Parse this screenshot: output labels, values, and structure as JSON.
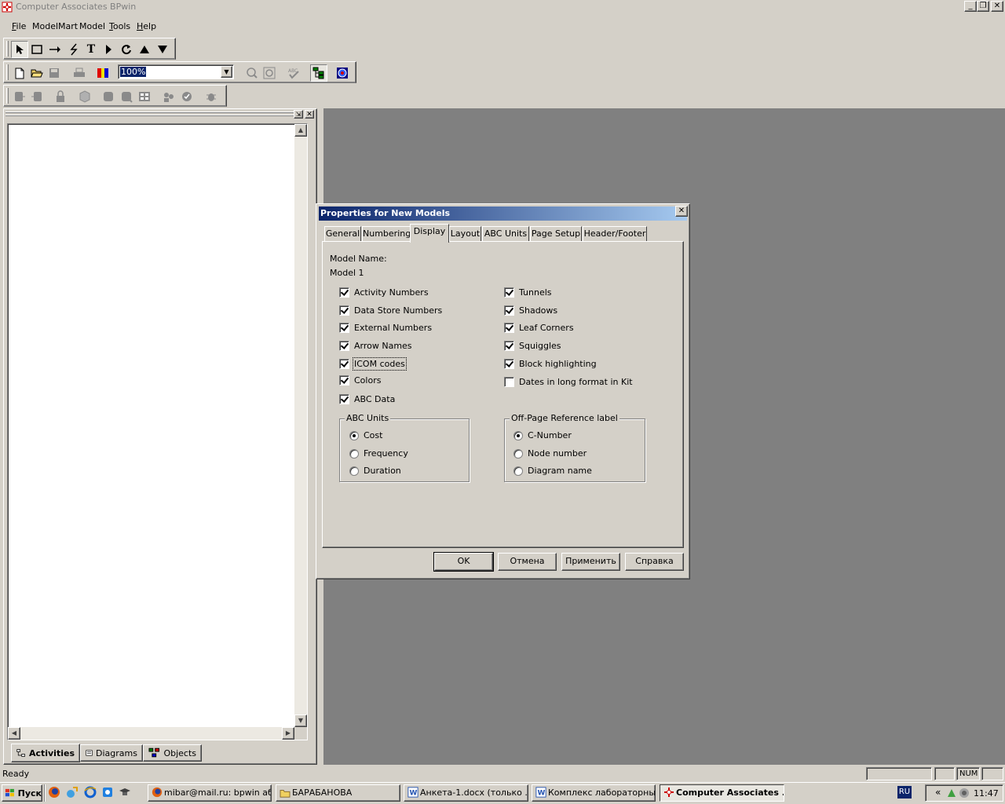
{
  "window": {
    "title": "Computer Associates BPwin",
    "min": "_",
    "restore": "❐",
    "close": "✕"
  },
  "menu": {
    "items": [
      {
        "accel": "F",
        "rest": "ile"
      },
      {
        "accel": "",
        "rest": "ModelMart"
      },
      {
        "accel": "",
        "rest": "Model"
      },
      {
        "accel": "T",
        "rest": "ools"
      },
      {
        "accel": "H",
        "rest": "elp"
      }
    ]
  },
  "toolbar": {
    "zoom": "100%"
  },
  "left_pane": {
    "tabs": [
      "Activities",
      "Diagrams",
      "Objects"
    ]
  },
  "dialog": {
    "title": "Properties for New Models",
    "tabs": [
      "General",
      "Numbering",
      "Display",
      "Layout",
      "ABC Units",
      "Page Setup",
      "Header/Footer"
    ],
    "active_tab": "Display",
    "model_name_label": "Model Name:",
    "model_name_value": "Model 1",
    "left_checks": [
      {
        "label": "Activity Numbers",
        "checked": true
      },
      {
        "label": "Data Store Numbers",
        "checked": true
      },
      {
        "label": "External Numbers",
        "checked": true
      },
      {
        "label": "Arrow Names",
        "checked": true
      },
      {
        "label": "ICOM codes",
        "checked": true
      },
      {
        "label": "Colors",
        "checked": true
      },
      {
        "label": "ABC Data",
        "checked": true
      }
    ],
    "right_checks": [
      {
        "label": "Tunnels",
        "checked": true
      },
      {
        "label": "Shadows",
        "checked": true
      },
      {
        "label": "Leaf Corners",
        "checked": true
      },
      {
        "label": "Squiggles",
        "checked": true
      },
      {
        "label": "Block highlighting",
        "checked": true
      },
      {
        "label": "Dates in long format in Kit",
        "checked": false
      }
    ],
    "abc_units": {
      "title": "ABC Units",
      "options": [
        "Cost",
        "Frequency",
        "Duration"
      ],
      "selected": "Cost"
    },
    "off_page": {
      "title": "Off-Page Reference label",
      "options": [
        "C-Number",
        "Node number",
        "Diagram name"
      ],
      "selected": "C-Number"
    },
    "buttons": {
      "ok": "OK",
      "cancel": "Отмена",
      "apply": "Применить",
      "help": "Справка"
    }
  },
  "statusbar": {
    "text": "Ready",
    "num": "NUM"
  },
  "taskbar": {
    "start": "Пуск",
    "tasks": [
      "mibar@mail.ru: bpwin аб...",
      "БАРАБАНОВА",
      "Анкета-1.docx (только ...",
      "Комплекс лабораторны...",
      "Computer Associates ..."
    ],
    "lang": "RU",
    "clock": "11:47"
  }
}
